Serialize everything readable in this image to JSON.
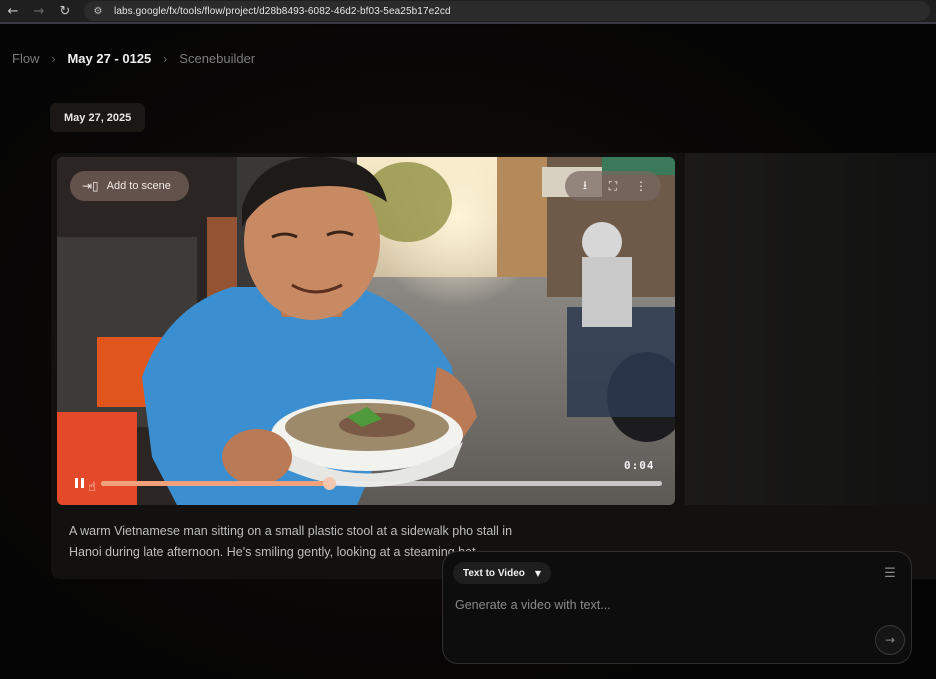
{
  "browser": {
    "url": "labs.google/fx/tools/flow/project/d28b8493-6082-46d2-bf03-5ea25b17e2cd",
    "back_icon": "arrow-left-icon",
    "forward_icon": "arrow-right-icon",
    "reload_icon": "reload-icon"
  },
  "breadcrumb": {
    "items": [
      "Flow",
      "May 27 - 0125",
      "Scenebuilder"
    ]
  },
  "date_label": "May 27, 2025",
  "video": {
    "add_to_scene_label": "Add to scene",
    "timecode": "0:04",
    "progress": 0.406,
    "tools": [
      "download-icon",
      "fullscreen-icon",
      "more-vert-icon"
    ]
  },
  "description": "A warm Vietnamese man sitting on a small plastic stool at a sidewalk pho stall in Hanoi during late afternoon. He's smiling gently, looking at a steaming bat",
  "composer": {
    "mode_label": "Text to Video",
    "placeholder": "Generate a video with text..."
  },
  "colors": {
    "accent": "#f0a07a",
    "shirt": "#3b8fd0"
  }
}
